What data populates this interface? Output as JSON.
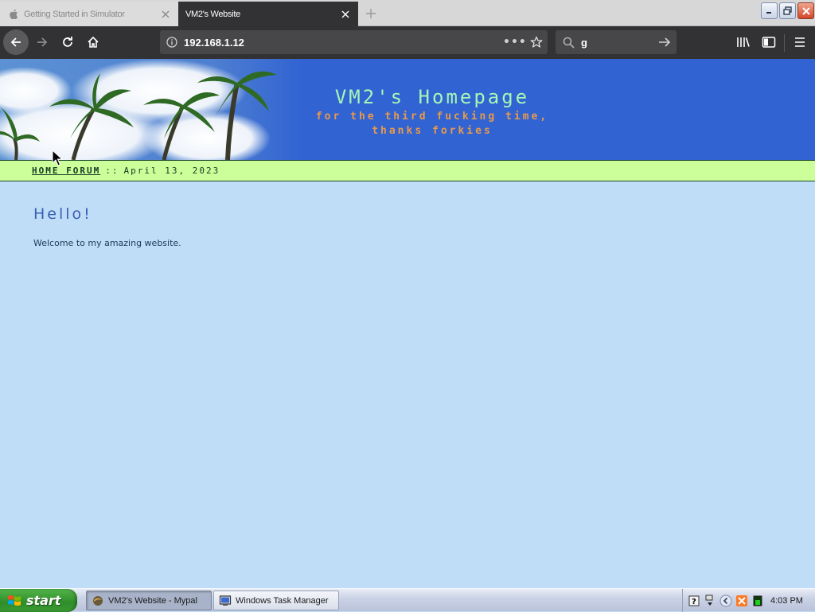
{
  "browser": {
    "tabs": [
      {
        "title": "Getting Started in Simulator",
        "active": false
      },
      {
        "title": "VM2's Website",
        "active": true
      }
    ],
    "address": "192.168.1.12",
    "search_value": "g",
    "more_label": "•••"
  },
  "site": {
    "title": "VM2's Homepage",
    "subtitle_line1": "for the third fucking time,",
    "subtitle_line2": "thanks forkies",
    "nav_link": "HOME FORUM",
    "nav_separator": "::",
    "date": "April 13, 2023",
    "heading": "Hello!",
    "body": "Welcome to my amazing website."
  },
  "taskbar": {
    "start_label": "start",
    "items": [
      {
        "label": "VM2's Website - Mypal",
        "active": true
      },
      {
        "label": "Windows Task Manager",
        "active": false
      }
    ],
    "clock": "4:03 PM"
  },
  "colors": {
    "toolbar": "#323234",
    "banner": "#3163d3",
    "site_title": "#a8f5b4",
    "site_subtitle": "#e89a4a",
    "navline": "#ccff99",
    "page_bg": "#c0ddf8",
    "heading": "#3a5fb2"
  }
}
